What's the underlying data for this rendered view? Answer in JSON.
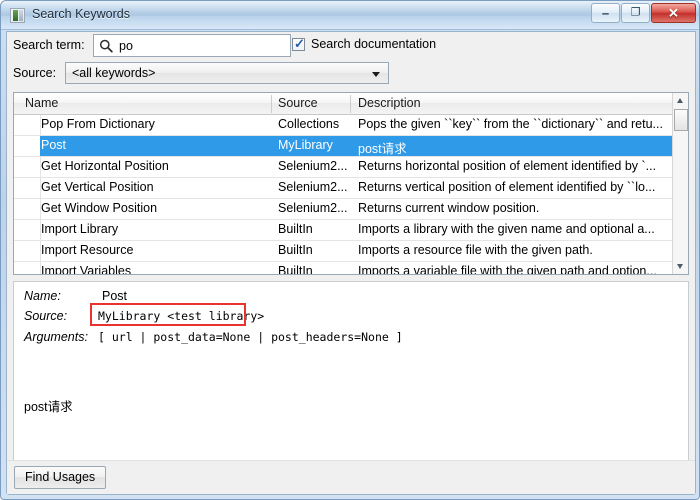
{
  "window": {
    "title": "Search Keywords",
    "icon": "app-icon",
    "controls": {
      "minimize": "–",
      "maximize": "❐",
      "close": "✕"
    }
  },
  "search": {
    "term_label": "Search term:",
    "icon": "search-icon",
    "value": "po",
    "checkbox_label": "Search documentation",
    "checkbox_checked": true,
    "checkmark": "✓"
  },
  "source_filter": {
    "label": "Source:",
    "selected": "<all keywords>"
  },
  "table": {
    "columns": [
      "Name",
      "Source",
      "Description"
    ],
    "rows": [
      {
        "name": "Pop From Dictionary",
        "source": "Collections",
        "description": "Pops the given ``key`` from the ``dictionary`` and retu...",
        "selected": false
      },
      {
        "name": "Post",
        "source": "MyLibrary",
        "description": "post请求",
        "selected": true
      },
      {
        "name": "Get Horizontal Position",
        "source": "Selenium2...",
        "description": "Returns horizontal position of element identified by `...",
        "selected": false
      },
      {
        "name": "Get Vertical Position",
        "source": "Selenium2...",
        "description": "Returns vertical position of element identified by ``lo...",
        "selected": false
      },
      {
        "name": "Get Window Position",
        "source": "Selenium2...",
        "description": "Returns current window position.",
        "selected": false
      },
      {
        "name": "Import Library",
        "source": "BuiltIn",
        "description": "Imports a library with the given name and optional a...",
        "selected": false
      },
      {
        "name": "Import Resource",
        "source": "BuiltIn",
        "description": "Imports a resource file with the given path.",
        "selected": false
      },
      {
        "name": "Import Variables",
        "source": "BuiltIn",
        "description": "Imports a variable file with the given path and option...",
        "selected": false
      }
    ],
    "scrollbar": {
      "up_arrow": "▲",
      "down_arrow": "▼"
    }
  },
  "details": {
    "name_label": "Name:",
    "name_value": "Post",
    "source_label": "Source:",
    "source_value": "MyLibrary <test library>",
    "arguments_label": "Arguments:",
    "arguments_value": "[ url | post_data=None | post_headers=None ]",
    "documentation": "post请求",
    "highlight_color": "#e8332f"
  },
  "footer": {
    "find_usages_label": "Find Usages"
  },
  "colors": {
    "selection_blue": "#2f9ae8",
    "title_bar": "#a9c6e2",
    "close_red": "#c2302a"
  }
}
